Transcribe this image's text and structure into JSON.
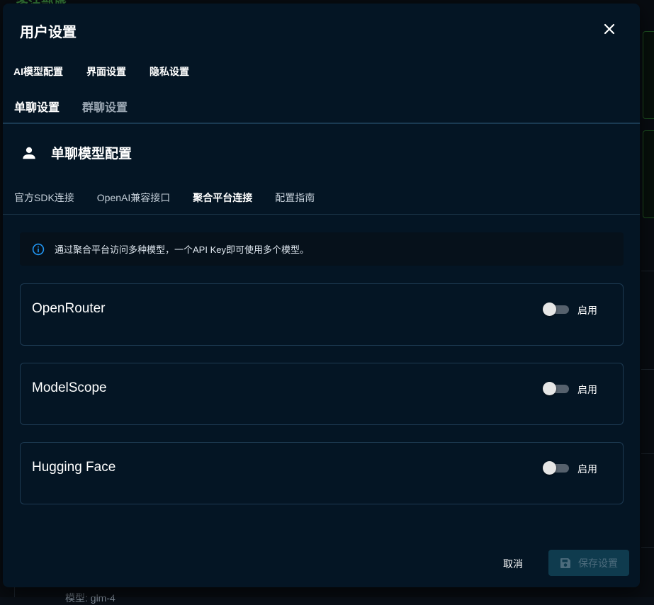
{
  "modal": {
    "title": "用户设置",
    "primary_tabs": [
      "AI模型配置",
      "界面设置",
      "隐私设置"
    ],
    "secondary_tabs": [
      {
        "label": "单聊设置",
        "active": true
      },
      {
        "label": "群聊设置",
        "active": false
      }
    ],
    "section_title": "单聊模型配置",
    "tertiary_tabs": [
      {
        "label": "官方SDK连接",
        "active": false
      },
      {
        "label": "OpenAI兼容接口",
        "active": false
      },
      {
        "label": "聚合平台连接",
        "active": true
      },
      {
        "label": "配置指南",
        "active": false
      }
    ],
    "info_text": "通过聚合平台访问多种模型，一个API Key即可使用多个模型。",
    "platforms": [
      {
        "name": "OpenRouter",
        "enable_label": "启用",
        "enabled": false
      },
      {
        "name": "ModelScope",
        "enable_label": "启用",
        "enabled": false
      },
      {
        "name": "Hugging Face",
        "enable_label": "启用",
        "enabled": false
      }
    ],
    "footer": {
      "cancel_label": "取消",
      "save_label": "保存设置"
    }
  },
  "colors": {
    "modal_bg": "#041524",
    "accent_green": "#4caf50",
    "save_button_bg": "#0f3b4e",
    "info_icon": "#2196f3"
  },
  "icons": [
    "close-icon",
    "user-icon",
    "info-icon",
    "save-icon"
  ]
}
